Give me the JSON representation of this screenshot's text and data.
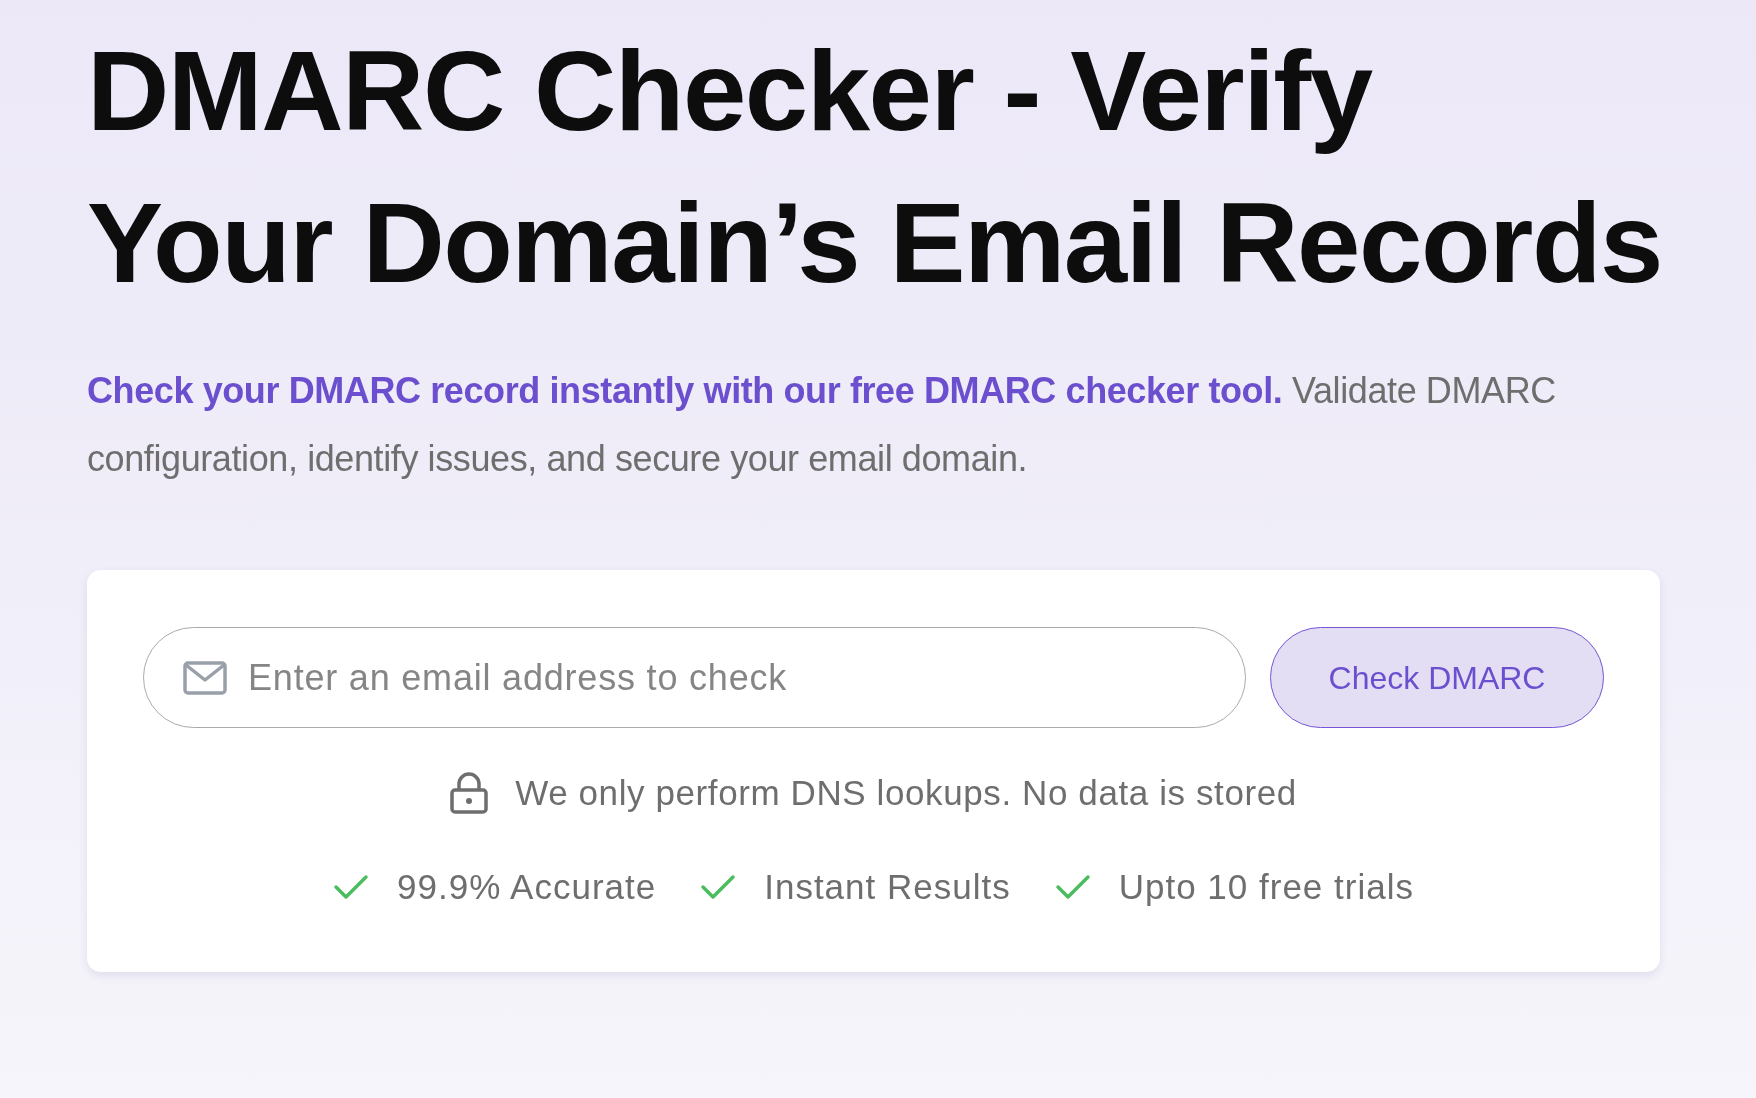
{
  "heading": "DMARC Checker - Verify\nYour Domain’s Email Records",
  "intro": "**Check your DMARC record instantly with our free DMARC checker tool.** Validate DMARC configuration, identify issues, and secure your email domain.",
  "checker": {
    "email_field": {
      "placeholder": "Enter an email address to check"
    },
    "submit_button": "Check DMARC",
    "privacy_note": "We only perform DNS lookups. No data is stored",
    "features": [
      "99.9% Accurate",
      "Instant Results",
      "Upto 10 free trials"
    ]
  }
}
